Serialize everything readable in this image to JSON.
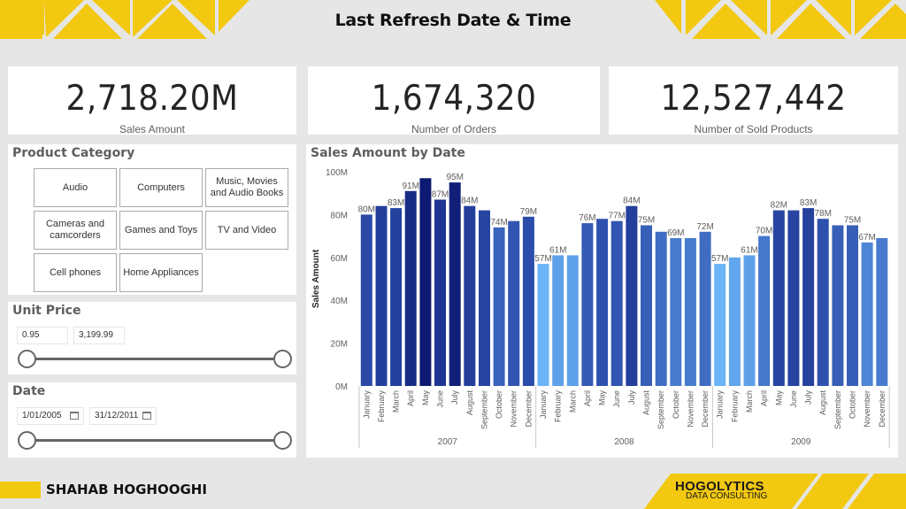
{
  "header": {
    "title": "Last Refresh Date & Time"
  },
  "kpis": [
    {
      "value": "2,718.20M",
      "label": "Sales Amount"
    },
    {
      "value": "1,674,320",
      "label": "Number of Orders"
    },
    {
      "value": "12,527,442",
      "label": "Number of Sold Products"
    }
  ],
  "product_category": {
    "title": "Product Category",
    "items": [
      "Audio",
      "Computers",
      "Music, Movies and Audio Books",
      "Cameras and camcorders",
      "Games and Toys",
      "TV and Video",
      "Cell phones",
      "Home Appliances"
    ]
  },
  "unit_price": {
    "title": "Unit Price",
    "min": "0.95",
    "max": "3,199.99"
  },
  "date_filter": {
    "title": "Date",
    "start": "1/01/2005",
    "end": "31/12/2011"
  },
  "footer": {
    "author": "SHAHAB HOGHOOGHI",
    "logo_main": "HOGOLYTICS",
    "logo_sub": "DATA CONSULTING"
  },
  "colors": {
    "accent": "#f2c811",
    "bar_dark": "#0c1a73",
    "bar_light": "#6ab4f7"
  },
  "chart_data": {
    "type": "bar",
    "title": "Sales Amount by Date",
    "xlabel": "",
    "ylabel": "Sales Amount",
    "ylim": [
      0,
      100
    ],
    "yticks": [
      "0M",
      "20M",
      "40M",
      "60M",
      "80M",
      "100M"
    ],
    "groups": [
      "2007",
      "2008",
      "2009"
    ],
    "categories": [
      "January",
      "February",
      "March",
      "April",
      "May",
      "June",
      "July",
      "August",
      "September",
      "October",
      "November",
      "December"
    ],
    "series": [
      {
        "name": "2007",
        "values": [
          80,
          84,
          83,
          91,
          97,
          87,
          95,
          84,
          82,
          74,
          77,
          79
        ]
      },
      {
        "name": "2008",
        "values": [
          57,
          61,
          61,
          76,
          78,
          77,
          84,
          75,
          72,
          69,
          69,
          72
        ]
      },
      {
        "name": "2009",
        "values": [
          57,
          60,
          61,
          70,
          82,
          82,
          83,
          78,
          75,
          75,
          67,
          69
        ]
      }
    ],
    "data_labels": [
      [
        "80M",
        "",
        "83M",
        "91M",
        "",
        "87M",
        "95M",
        "84M",
        "",
        "74M",
        "",
        "79M"
      ],
      [
        "57M",
        "61M",
        "",
        "76M",
        "",
        "77M",
        "84M",
        "75M",
        "",
        "69M",
        "",
        "72M"
      ],
      [
        "57M",
        "",
        "61M",
        "70M",
        "82M",
        "",
        "83M",
        "78M",
        "",
        "75M",
        "67M",
        ""
      ]
    ],
    "grid": false,
    "legend": "none"
  }
}
